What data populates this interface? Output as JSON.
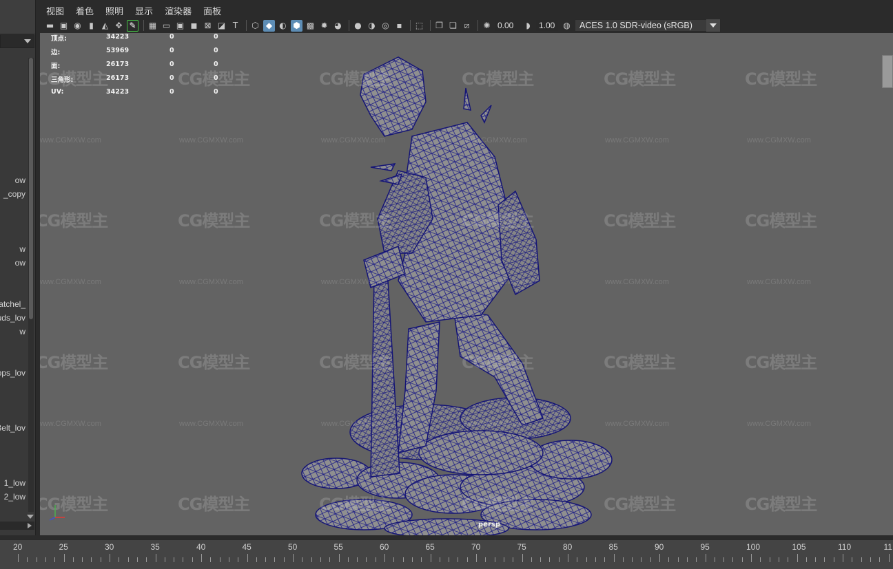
{
  "menubar": {
    "items": [
      "视图",
      "着色",
      "照明",
      "显示",
      "渲染器",
      "面板"
    ]
  },
  "toolbar": {
    "field_exposure": "0.00",
    "field_gamma": "1.00",
    "color_management": "ACES 1.0 SDR-video (sRGB)"
  },
  "outliner": {
    "items": [
      "ow",
      "_copy",
      "w",
      "ow",
      "atchel_",
      "uds_lov",
      "w",
      "ops_lov",
      "Belt_lov",
      "1_low",
      "2_low"
    ]
  },
  "hud": {
    "rows": [
      {
        "label": "顶点:",
        "v1": "34223",
        "v2": "0",
        "v3": "0"
      },
      {
        "label": "边:",
        "v1": "53969",
        "v2": "0",
        "v3": "0"
      },
      {
        "label": "面:",
        "v1": "26173",
        "v2": "0",
        "v3": "0"
      },
      {
        "label": "三角形:",
        "v1": "26173",
        "v2": "0",
        "v3": "0"
      },
      {
        "label": "UV:",
        "v1": "34223",
        "v2": "0",
        "v3": "0"
      }
    ]
  },
  "watermark": {
    "logo": "CG模型主",
    "url": "www.CGMXW.com"
  },
  "viewport": {
    "camera": "persp"
  },
  "timeline": {
    "ticks": [
      "20",
      "25",
      "30",
      "35",
      "40",
      "45",
      "50",
      "55",
      "60",
      "65",
      "70",
      "75",
      "80",
      "85",
      "90",
      "95",
      "100",
      "105",
      "110",
      "11"
    ]
  },
  "colors": {
    "viewport_bg": "#636363",
    "wireframe": "#1a1a7a",
    "active_icon": "#5d8db5"
  }
}
